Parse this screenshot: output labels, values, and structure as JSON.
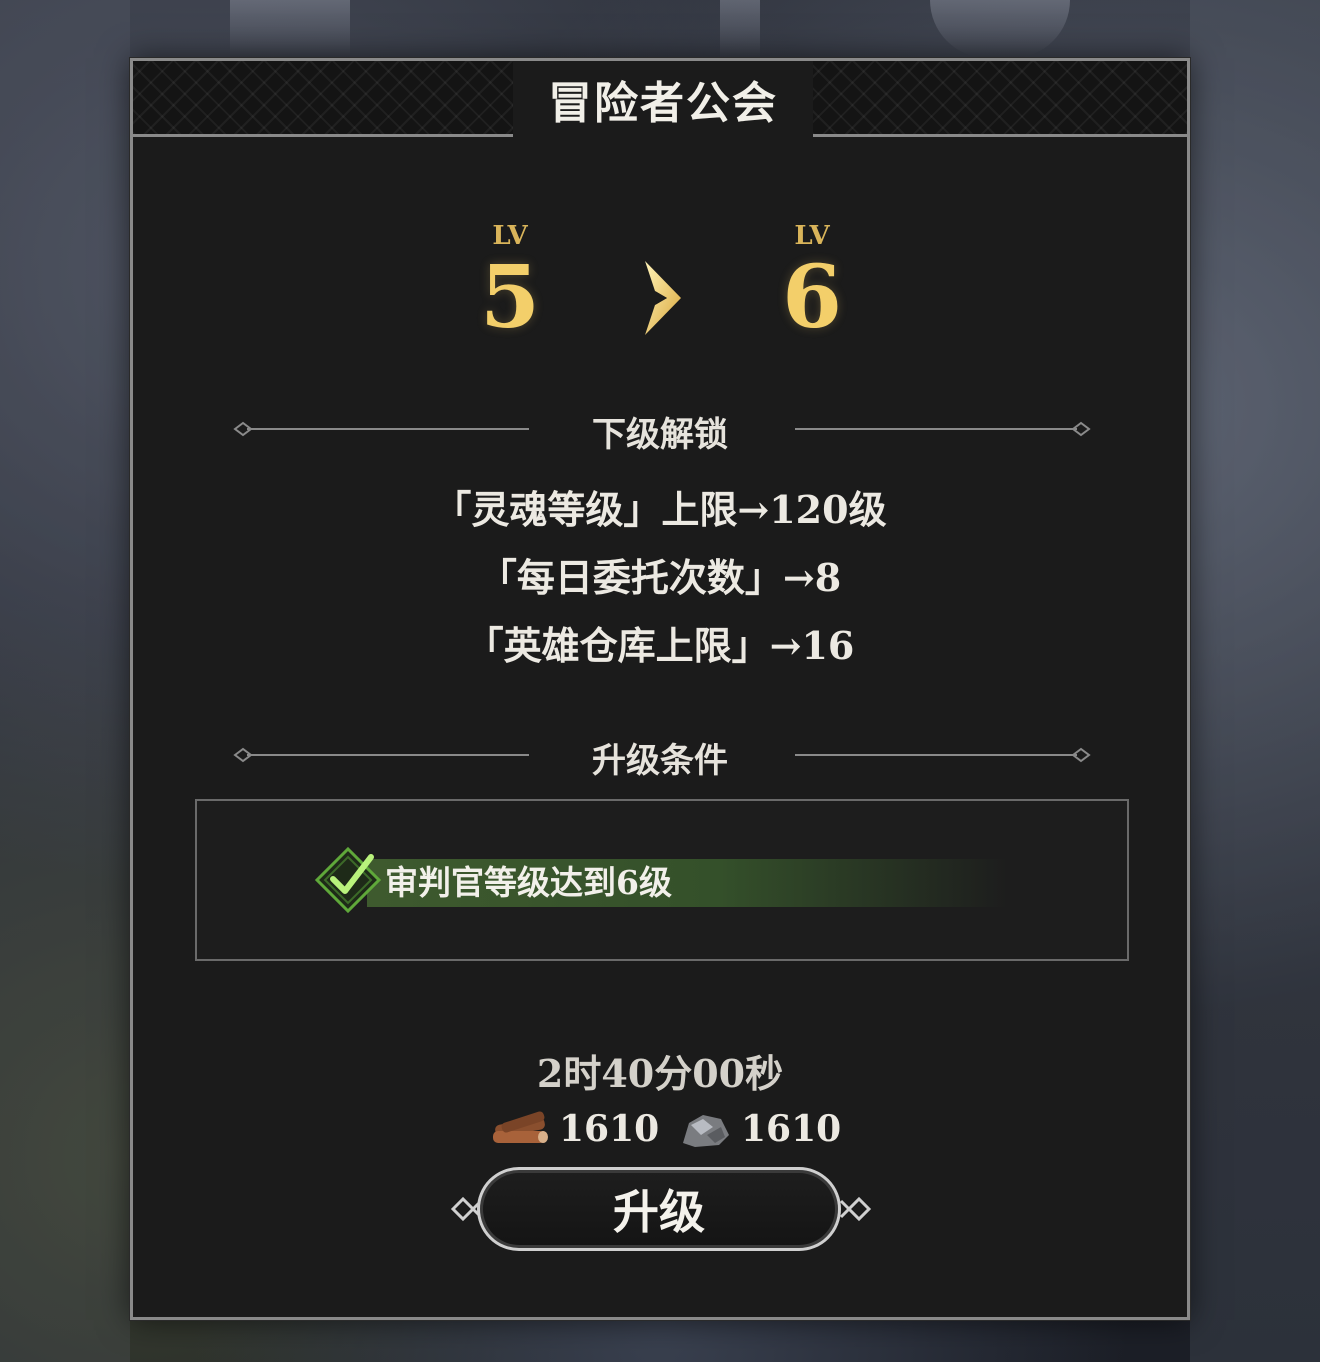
{
  "panel": {
    "title": "冒险者公会"
  },
  "level": {
    "current_label": "LV",
    "current": "5",
    "next_label": "LV",
    "next": "6"
  },
  "unlocks": {
    "heading": "下级解锁",
    "items": [
      "「灵魂等级」上限→120级",
      "「每日委托次数」→8",
      "「英雄仓库上限」→16"
    ]
  },
  "conditions": {
    "heading": "升级条件",
    "items": [
      {
        "text": "审判官等级达到6级",
        "met": true
      }
    ]
  },
  "cost": {
    "time": "2时40分00秒",
    "wood": "1610",
    "ore": "1610"
  },
  "upgrade_button": {
    "label": "升级"
  },
  "colors": {
    "gold": "#f3cf6a",
    "panel": "#1b1b1b",
    "condition_met": "#3e5a2e",
    "check": "#7fd84a"
  }
}
